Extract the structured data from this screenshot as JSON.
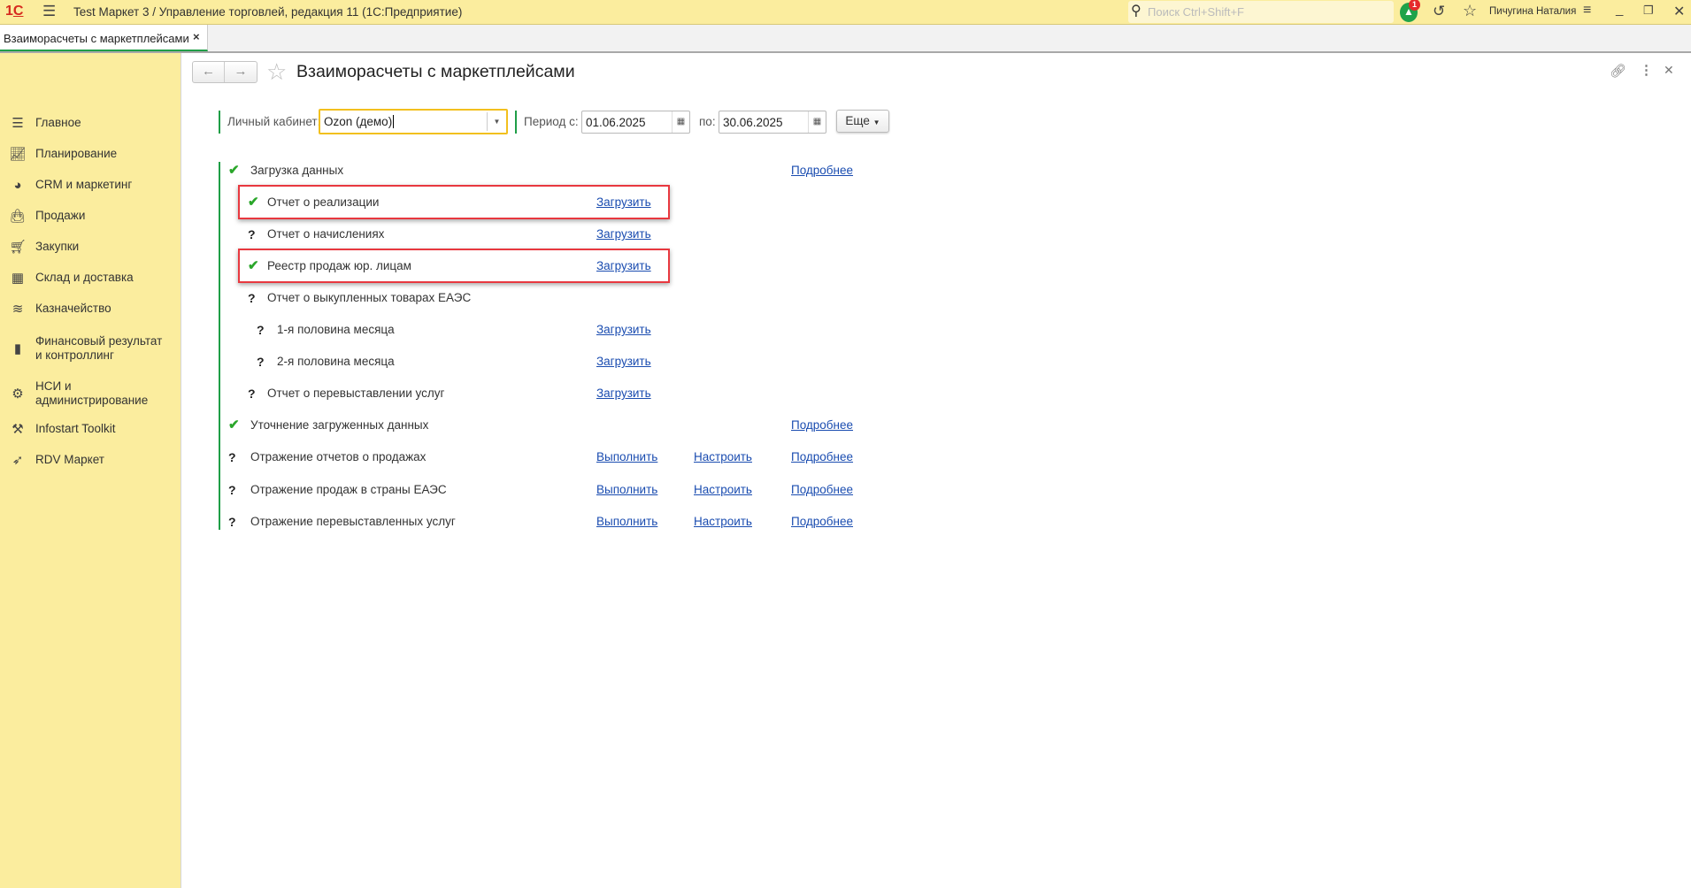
{
  "titlebar": {
    "title": "Test Маркет 3 / Управление торговлей, редакция 11  (1С:Предприятие)",
    "search_placeholder": "Поиск Ctrl+Shift+F",
    "notification_count": "1",
    "user": "Пичугина Наталия"
  },
  "tabs": [
    {
      "label": "Взаиморасчеты с маркетплейсами",
      "active": true
    }
  ],
  "sidebar": {
    "items": [
      {
        "label": "Главное",
        "icon": "menu-icon"
      },
      {
        "label": "Планирование",
        "icon": "planning-icon"
      },
      {
        "label": "CRM и маркетинг",
        "icon": "pie-chart-icon"
      },
      {
        "label": "Продажи",
        "icon": "shopping-bag-icon"
      },
      {
        "label": "Закупки",
        "icon": "cart-icon"
      },
      {
        "label": "Склад и доставка",
        "icon": "warehouse-icon"
      },
      {
        "label": "Казначейство",
        "icon": "coins-icon"
      },
      {
        "label": "Финансовый результат и контроллинг",
        "icon": "bar-chart-icon"
      },
      {
        "label": "НСИ и администрирование",
        "icon": "gear-icon"
      },
      {
        "label": "Infostart Toolkit",
        "icon": "tools-icon"
      },
      {
        "label": "RDV Маркет",
        "icon": "rocket-icon"
      }
    ]
  },
  "page": {
    "title": "Взаиморасчеты с маркетплейсами",
    "cabinet_label": "Личный кабинет:",
    "cabinet_value": "Ozon (демо)",
    "period_from_label": "Период с:",
    "period_from": "01.06.2025",
    "period_to_label": "по:",
    "period_to": "30.06.2025",
    "more_button": "Еще"
  },
  "rows": [
    {
      "status": "check",
      "level": 0,
      "label": "Загрузка данных",
      "more": "Подробнее"
    },
    {
      "status": "check",
      "level": 1,
      "label": "Отчет о реализации",
      "load": "Загрузить",
      "highlighted": true
    },
    {
      "status": "question",
      "level": 1,
      "label": "Отчет о начислениях",
      "load": "Загрузить"
    },
    {
      "status": "check",
      "level": 1,
      "label": "Реестр продаж юр. лицам",
      "load": "Загрузить",
      "highlighted": true
    },
    {
      "status": "question",
      "level": 1,
      "label": "Отчет о выкупленных товарах ЕАЭС"
    },
    {
      "status": "question",
      "level": 2,
      "label": "1-я половина месяца",
      "load": "Загрузить"
    },
    {
      "status": "question",
      "level": 2,
      "label": "2-я половина месяца",
      "load": "Загрузить"
    },
    {
      "status": "question",
      "level": 1,
      "label": "Отчет о перевыставлении услуг",
      "load": "Загрузить"
    },
    {
      "status": "check",
      "level": 0,
      "label": "Уточнение загруженных данных",
      "more": "Подробнее"
    },
    {
      "status": "question",
      "level": 0,
      "label": "Отражение отчетов о продажах",
      "run": "Выполнить",
      "setup": "Настроить",
      "more": "Подробнее"
    },
    {
      "status": "question",
      "level": 0,
      "label": "Отражение продаж в страны ЕАЭС",
      "run": "Выполнить",
      "setup": "Настроить",
      "more": "Подробнее"
    },
    {
      "status": "question",
      "level": 0,
      "label": "Отражение перевыставленных услуг",
      "run": "Выполнить",
      "setup": "Настроить",
      "more": "Подробнее"
    }
  ],
  "colors": {
    "accent_green": "#2aa62a",
    "highlight_red": "#e8383f",
    "link": "#1a4cb0",
    "panel_yellow": "#fbed9e"
  }
}
